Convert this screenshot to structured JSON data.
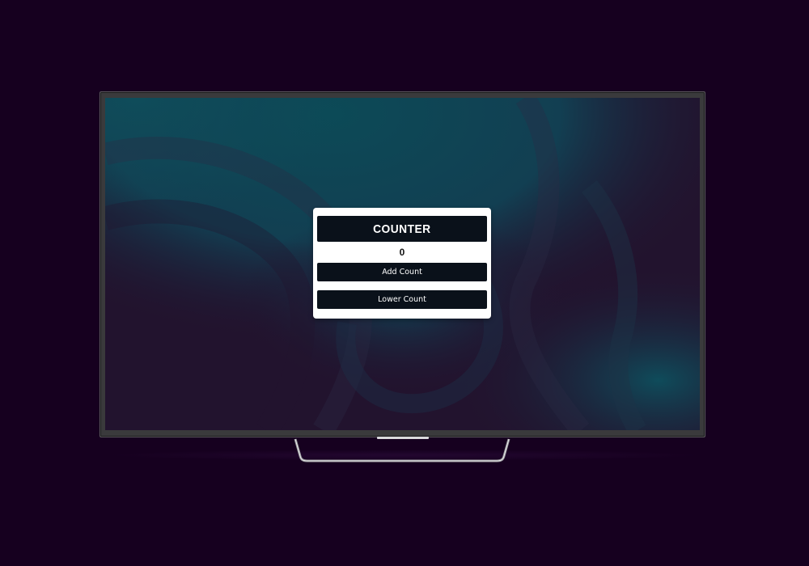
{
  "counter": {
    "title": "COUNTER",
    "value": "0",
    "add_label": "Add Count",
    "lower_label": "Lower Count"
  },
  "colors": {
    "page_background": "#16001f",
    "screen_teal": "#0e4a55",
    "screen_purple": "#22132e",
    "card_background": "#ffffff",
    "button_background": "#0a111a",
    "button_text": "#ffffff"
  },
  "icons": {
    "device": "tv-icon"
  }
}
